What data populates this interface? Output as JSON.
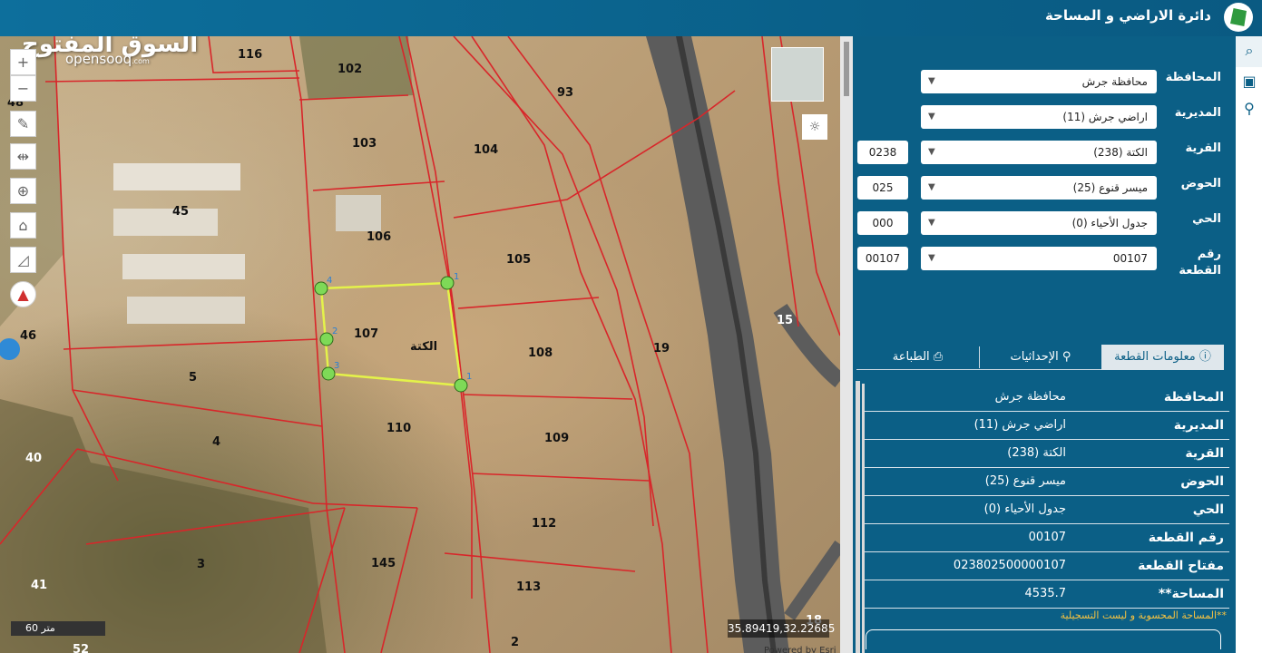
{
  "header": {
    "title": "دائرة الاراضي و المساحة",
    "logo_icon": "dls-logo-icon"
  },
  "map": {
    "watermark": "السوق المفتوح",
    "watermark_sub": "opensooq",
    "watermark_sub_suffix": ".com",
    "scale_label": "60 متر",
    "coords": "35.89419,32.22685",
    "powered_by": "Powered by Esri",
    "parcel_label_center": "الكتة",
    "plot_numbers": [
      "116",
      "102",
      "93",
      "103",
      "104",
      "45",
      "106",
      "105",
      "48",
      "46",
      "107",
      "108",
      "19",
      "15",
      "5",
      "110",
      "109",
      "4",
      "40",
      "112",
      "3",
      "145",
      "41",
      "113",
      "52",
      "2",
      "18"
    ],
    "vertex_labels": [
      "1",
      "2",
      "3",
      "4",
      "1"
    ],
    "tools": [
      "zoom-in-icon",
      "zoom-out-icon",
      "draw-icon",
      "measure-icon",
      "locate-icon",
      "home-icon",
      "area-icon",
      "compass-icon"
    ]
  },
  "form": {
    "fields": [
      {
        "label": "المحافظة",
        "value": "محافظة جرش",
        "code": null
      },
      {
        "label": "المديرية",
        "value": "اراضي جرش (11)",
        "code": null
      },
      {
        "label": "القرية",
        "value": "الكتة (238)",
        "code": "0238"
      },
      {
        "label": "الحوض",
        "value": "ميسر قنوع (25)",
        "code": "025"
      },
      {
        "label": "الحي",
        "value": "جدول الأحياء (0)",
        "code": "000"
      },
      {
        "label": "رقم القطعة",
        "value": "00107",
        "code": "00107"
      }
    ]
  },
  "tabs": {
    "info": "معلومات القطعة",
    "coords": "الإحداثيات",
    "print": "الطباعة"
  },
  "info": {
    "rows": [
      {
        "key": "المحافظة",
        "value": "محافظة جرش"
      },
      {
        "key": "المديرية",
        "value": "اراضي جرش (11)"
      },
      {
        "key": "القرية",
        "value": "الكتة (238)"
      },
      {
        "key": "الحوض",
        "value": "ميسر قنوع (25)"
      },
      {
        "key": "الحي",
        "value": "جدول الأحياء (0)"
      },
      {
        "key": "رقم القطعة",
        "value": "00107"
      },
      {
        "key": "مفتاح القطعة",
        "value": "023802500000107"
      },
      {
        "key": "المساحة**",
        "value": "4535.7"
      }
    ],
    "note": "**المساحة المحسوبة و ليست التسجيلية"
  },
  "colors": {
    "panel": "#0b5f86",
    "parcel_lines": "#d8262a",
    "selected_parcel": "#e4f24a",
    "vertex": "#7ed957",
    "note": "#f4c242"
  }
}
